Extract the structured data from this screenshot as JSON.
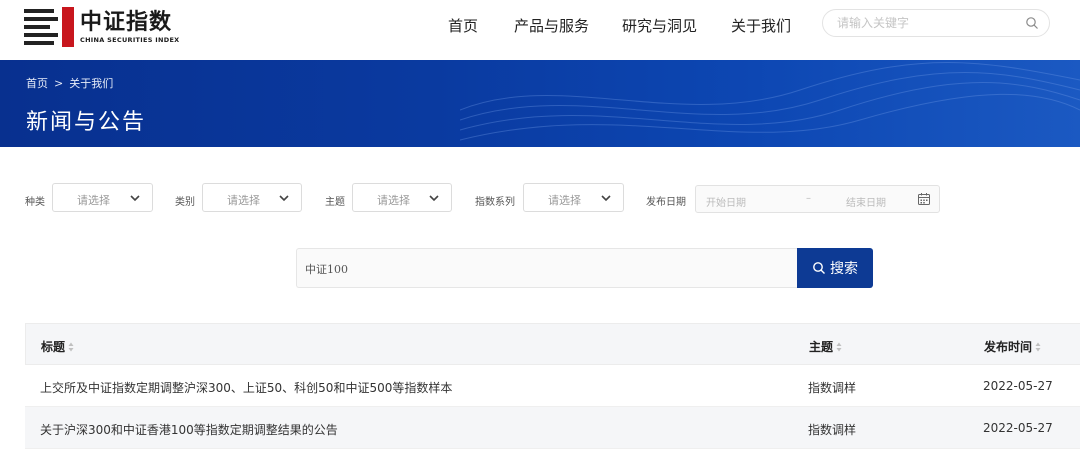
{
  "brand": {
    "name_cn": "中证指数",
    "name_en": "CHINA SECURITIES INDEX"
  },
  "nav": {
    "items": [
      {
        "label": "首页"
      },
      {
        "label": "产品与服务"
      },
      {
        "label": "研究与洞见"
      },
      {
        "label": "关于我们"
      }
    ],
    "search_placeholder": "请输入关键字"
  },
  "banner": {
    "breadcrumb": [
      "首页",
      "关于我们"
    ],
    "breadcrumb_sep": ">",
    "title": "新闻与公告"
  },
  "filters": {
    "fields": [
      {
        "label": "种类",
        "value": "请选择"
      },
      {
        "label": "类别",
        "value": "请选择"
      },
      {
        "label": "主题",
        "value": "请选择"
      },
      {
        "label": "指数系列",
        "value": "请选择"
      }
    ],
    "date": {
      "label": "发布日期",
      "start_placeholder": "开始日期",
      "separator": "–",
      "end_placeholder": "结束日期"
    }
  },
  "search": {
    "value": "中证100",
    "button_label": "搜索"
  },
  "table": {
    "columns": [
      "标题",
      "主题",
      "发布时间"
    ],
    "rows": [
      {
        "title": "上交所及中证指数定期调整沪深300、上证50、科创50和中证500等指数样本",
        "topic": "指数调样",
        "date": "2022-05-27"
      },
      {
        "title": "关于沪深300和中证香港100等指数定期调整结果的公告",
        "topic": "指数调样",
        "date": "2022-05-27"
      }
    ]
  },
  "colors": {
    "brand_red": "#c8161d",
    "banner_blue": "#0a3aa0",
    "button_blue": "#0d3a94"
  }
}
